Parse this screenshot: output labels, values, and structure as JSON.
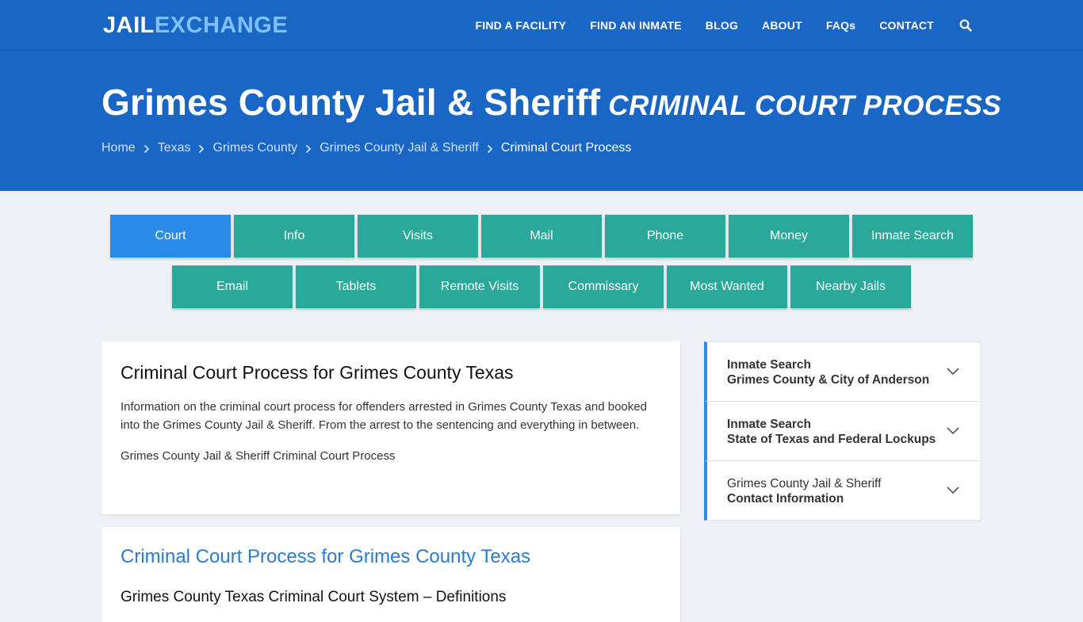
{
  "nav": {
    "logo_a": "JAIL",
    "logo_b": "EXCHANGE",
    "items": [
      "FIND A FACILITY",
      "FIND AN INMATE",
      "BLOG",
      "ABOUT",
      "FAQs",
      "CONTACT"
    ]
  },
  "hero": {
    "title": "Grimes County Jail & Sheriff",
    "subtitle": "CRIMINAL COURT PROCESS",
    "breadcrumbs": [
      "Home",
      "Texas",
      "Grimes County",
      "Grimes County Jail & Sheriff"
    ],
    "current": "Criminal Court Process"
  },
  "tabs": {
    "row1": [
      "Court",
      "Info",
      "Visits",
      "Mail",
      "Phone",
      "Money",
      "Inmate Search"
    ],
    "row2": [
      "Email",
      "Tablets",
      "Remote Visits",
      "Commissary",
      "Most Wanted",
      "Nearby Jails"
    ]
  },
  "main": {
    "card1_title": "Criminal Court Process for Grimes County Texas",
    "card1_text": "Information on the criminal court process for offenders arrested in Grimes County Texas and booked into the Grimes County Jail & Sheriff. From the arrest to the sentencing and everything in between.",
    "card1_link": "Grimes County Jail & Sheriff Criminal Court Process",
    "card2_title": "Criminal Court Process for Grimes County Texas",
    "card2_subtitle": "Grimes County Texas Criminal Court System – Definitions"
  },
  "sidebar": [
    {
      "line1": "Inmate Search",
      "line2": "Grimes County & City of Anderson"
    },
    {
      "line1": "Inmate Search",
      "line2": "State of Texas and Federal Lockups"
    },
    {
      "line1": "Grimes County Jail & Sheriff",
      "line2": "Contact Information"
    }
  ],
  "colors": {
    "brand_blue": "#1a66c5",
    "tab_teal": "#2aa89a",
    "tab_active": "#2a8ae8"
  }
}
